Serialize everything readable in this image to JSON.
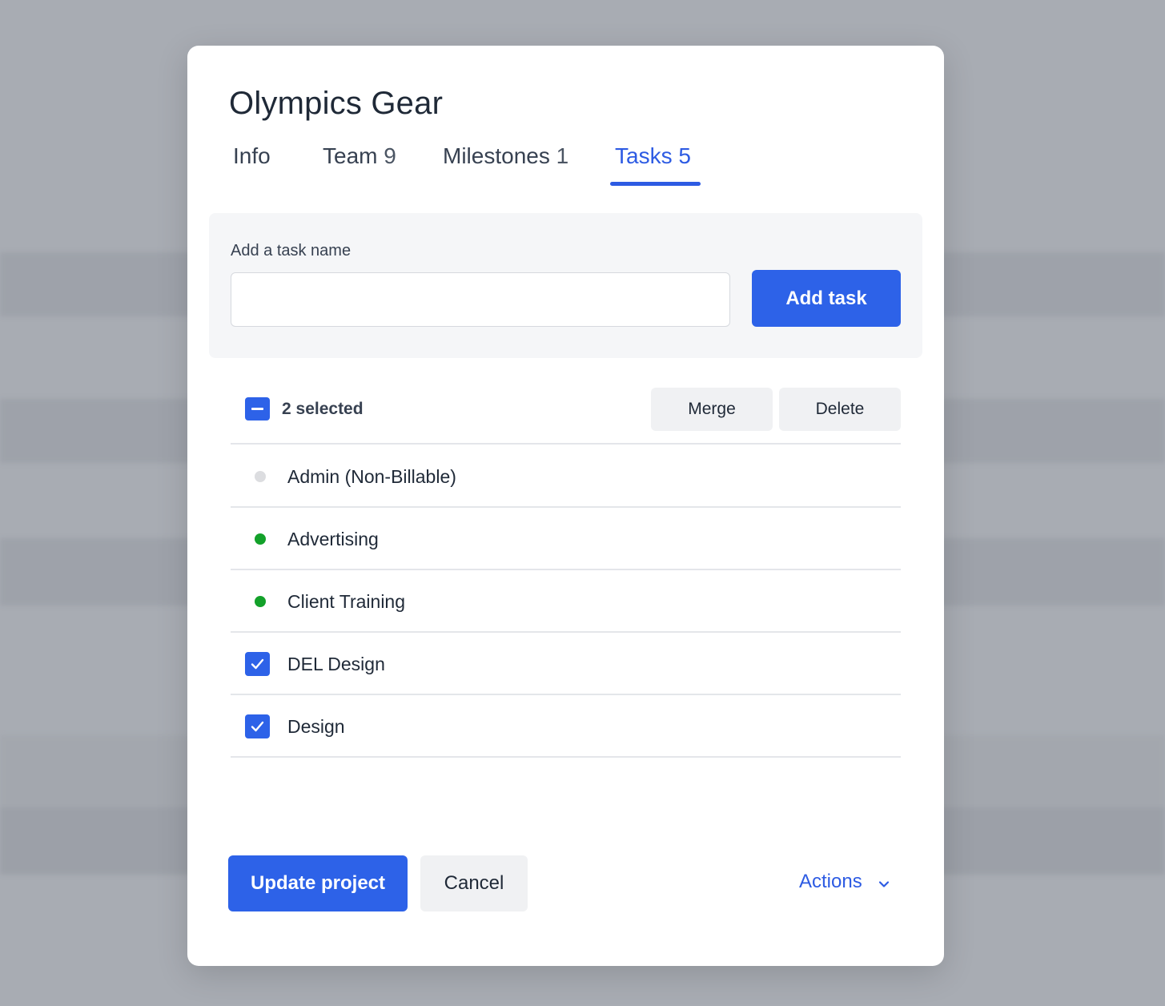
{
  "modal": {
    "title": "Olympics Gear",
    "tabs": [
      {
        "label": "Info",
        "count": ""
      },
      {
        "label": "Team",
        "count": "9"
      },
      {
        "label": "Milestones",
        "count": "1"
      },
      {
        "label": "Tasks",
        "count": "5"
      }
    ],
    "active_tab": "Tasks",
    "add_task": {
      "label": "Add a task name",
      "value": "",
      "placeholder": "",
      "button": "Add task"
    },
    "selection": {
      "text": "2 selected",
      "merge": "Merge",
      "delete": "Delete"
    },
    "tasks": [
      {
        "name": "Admin (Non-Billable)",
        "marker": "gray-dot",
        "selected": false
      },
      {
        "name": "Advertising",
        "marker": "green-dot",
        "selected": false
      },
      {
        "name": "Client Training",
        "marker": "green-dot",
        "selected": false
      },
      {
        "name": "DEL Design",
        "marker": "checkbox",
        "selected": true
      },
      {
        "name": "Design",
        "marker": "checkbox",
        "selected": true
      }
    ],
    "footer": {
      "update": "Update project",
      "cancel": "Cancel",
      "actions": "Actions"
    }
  },
  "colors": {
    "accent": "#2d62e8",
    "active_dot": "#13a12a",
    "inactive_dot": "#dcdde0",
    "overlay": "#a8acb3"
  }
}
